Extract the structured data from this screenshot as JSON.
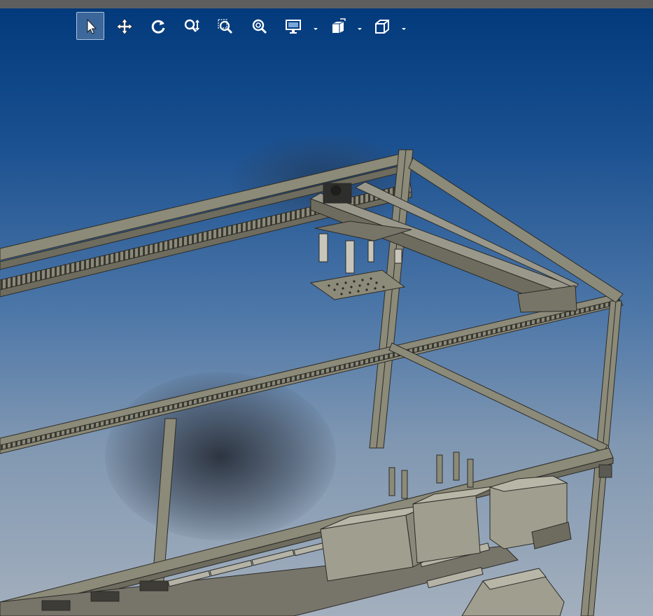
{
  "window": {
    "titlebar_color": "#5e5e5e"
  },
  "viewport": {
    "background_top": "#023a7c",
    "background_bottom": "#a3afbd"
  },
  "toolbar": {
    "buttons": [
      {
        "name": "select-tool-button",
        "icon": "arrow-pointer-icon",
        "active": true
      },
      {
        "name": "pan-tool-button",
        "icon": "move-arrows-icon",
        "active": false
      },
      {
        "name": "rotate-tool-button",
        "icon": "rotate-icon",
        "active": false
      },
      {
        "name": "zoom-tool-button",
        "icon": "zoom-updown-icon",
        "active": false
      },
      {
        "name": "zoom-window-button",
        "icon": "zoom-window-icon",
        "active": false
      },
      {
        "name": "zoom-fit-button",
        "icon": "zoom-fit-icon",
        "active": false
      },
      {
        "name": "display-mode-button",
        "icon": "monitor-icon",
        "active": false,
        "has_dropdown": true
      },
      {
        "name": "view-orientation-button",
        "icon": "cube-views-icon",
        "active": false,
        "has_dropdown": true
      },
      {
        "name": "projection-button",
        "icon": "wire-cube-icon",
        "active": false,
        "has_dropdown": true
      }
    ]
  },
  "model": {
    "description_colors": {
      "frame": "#8c8a78",
      "frame_edge": "#2b2b28",
      "box": "#a09e8e"
    }
  }
}
